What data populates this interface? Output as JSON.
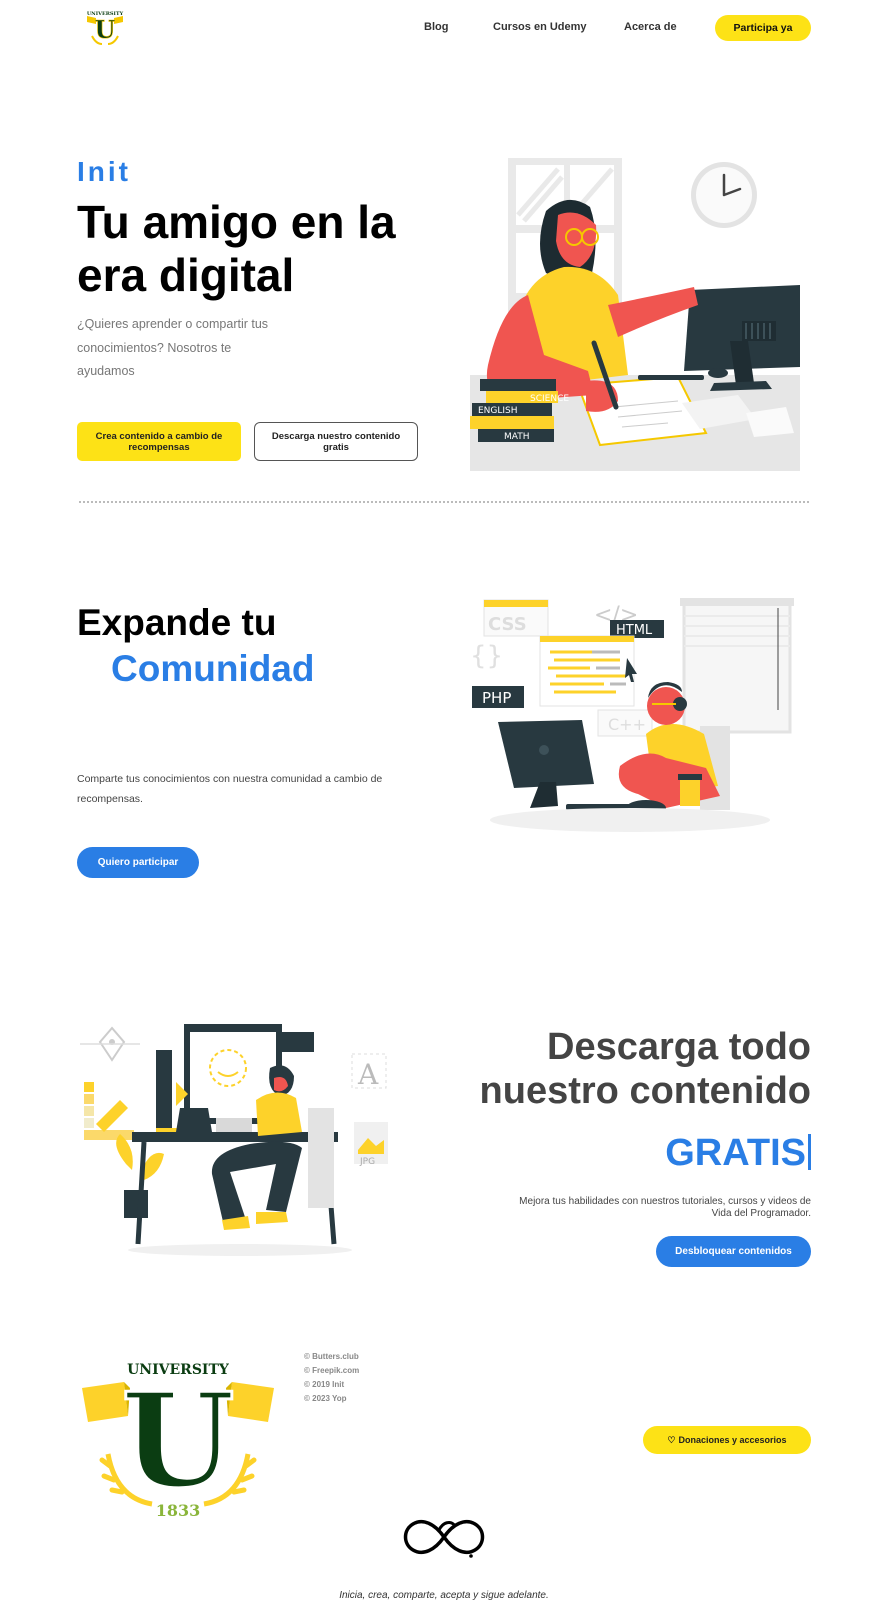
{
  "nav": {
    "logo_alt": "University logo",
    "links": [
      "Blog",
      "Cursos en Udemy",
      "Acerca de"
    ],
    "cta": "Participa ya"
  },
  "hero": {
    "eyebrow": "Init",
    "title": "Tu amigo en la era digital",
    "subtitle": "¿Quieres aprender o compartir tus conocimientos? Nosotros te ayudamos",
    "btn_primary": "Crea contenido a cambio de recompensas",
    "btn_secondary": "Descarga nuestro contenido gratis",
    "books": [
      "SCIENCE",
      "ENGLISH",
      "MATH"
    ]
  },
  "community": {
    "title_line1": "Expande tu",
    "title_line2": "Comunidad",
    "text": "Comparte tus conocimientos con nuestra comunidad a cambio de recompensas.",
    "button": "Quiero participar",
    "tags": [
      "CSS",
      "HTML",
      "PHP",
      "C++",
      "</>",
      "{}"
    ]
  },
  "download": {
    "title": "Descarga todo nuestro contenido",
    "highlight": "GRATIS",
    "text": "Mejora tus habilidades con nuestros tutoriales, cursos y videos de Vida del Programador.",
    "button": "Desbloquear contenidos",
    "file_label": "JPG",
    "glyph": "A"
  },
  "footer": {
    "logo": {
      "top": "UNIVERSITY",
      "letter": "U",
      "year": "1833"
    },
    "credits": [
      "© Butters.club",
      "© Freepik.com",
      "© 2019 Init",
      "© 2023 Yop"
    ],
    "donate": "Donaciones y accesorios",
    "motto": "Inicia, crea, comparte, acepta y sigue adelante."
  },
  "colors": {
    "accent_blue": "#2a7ee5",
    "accent_yellow": "#fde216",
    "logo_green": "#0b3d12",
    "illustration_red": "#f05550"
  }
}
